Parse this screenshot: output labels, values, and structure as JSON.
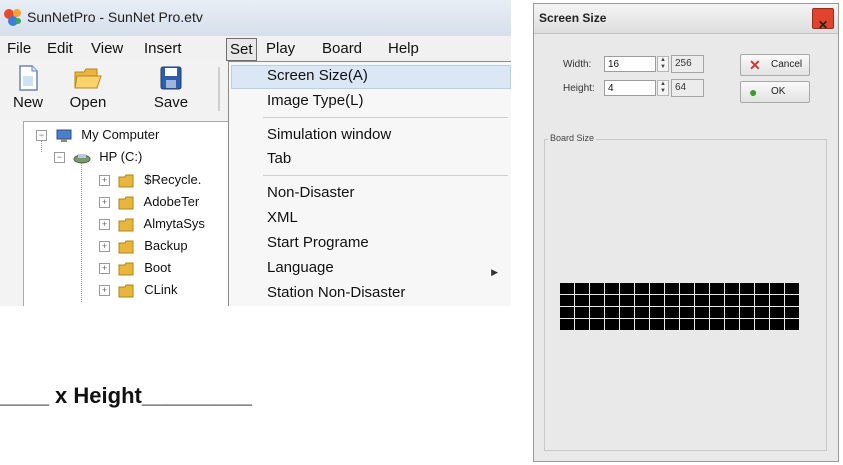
{
  "app": {
    "title": "SunNetPro - SunNet Pro.etv",
    "menu": [
      "File",
      "Edit",
      "View",
      "Insert",
      "Set",
      "Play",
      "Board",
      "Help"
    ],
    "toolbar": [
      {
        "label": "New",
        "icon": "new-file-icon"
      },
      {
        "label": "Open",
        "icon": "open-folder-icon"
      },
      {
        "label": "Save",
        "icon": "save-disk-icon"
      }
    ],
    "tree": {
      "root": "My Computer",
      "drive": "HP (C:)",
      "folders": [
        "$Recycle.",
        "AdobeTer",
        "AlmytaSys",
        "Backup",
        "Boot",
        "CLink"
      ]
    },
    "set_menu": {
      "groups": [
        [
          "Screen Size(A)",
          "Image Type(L)"
        ],
        [
          "Simulation window",
          "Tab"
        ],
        [
          "Non-Disaster",
          "XML",
          "Start Programe",
          "Language",
          "Station Non-Disaster"
        ]
      ],
      "highlighted": "Screen Size(A)",
      "submenu_item": "Language"
    }
  },
  "caption": "____ x Height_________",
  "dialog": {
    "title": "Screen Size",
    "width_label": "Width:",
    "width_value": "16",
    "width_pixels": "256",
    "height_label": "Height:",
    "height_value": "4",
    "height_pixels": "64",
    "cancel_label": "Cancel",
    "ok_label": "OK",
    "group_label": "Board Size",
    "board": {
      "columns": 16,
      "rows": 4
    },
    "colors": {
      "close": "#e0442e",
      "cancel_icon": "#d93030",
      "ok_icon": "#3c9a2f"
    }
  }
}
